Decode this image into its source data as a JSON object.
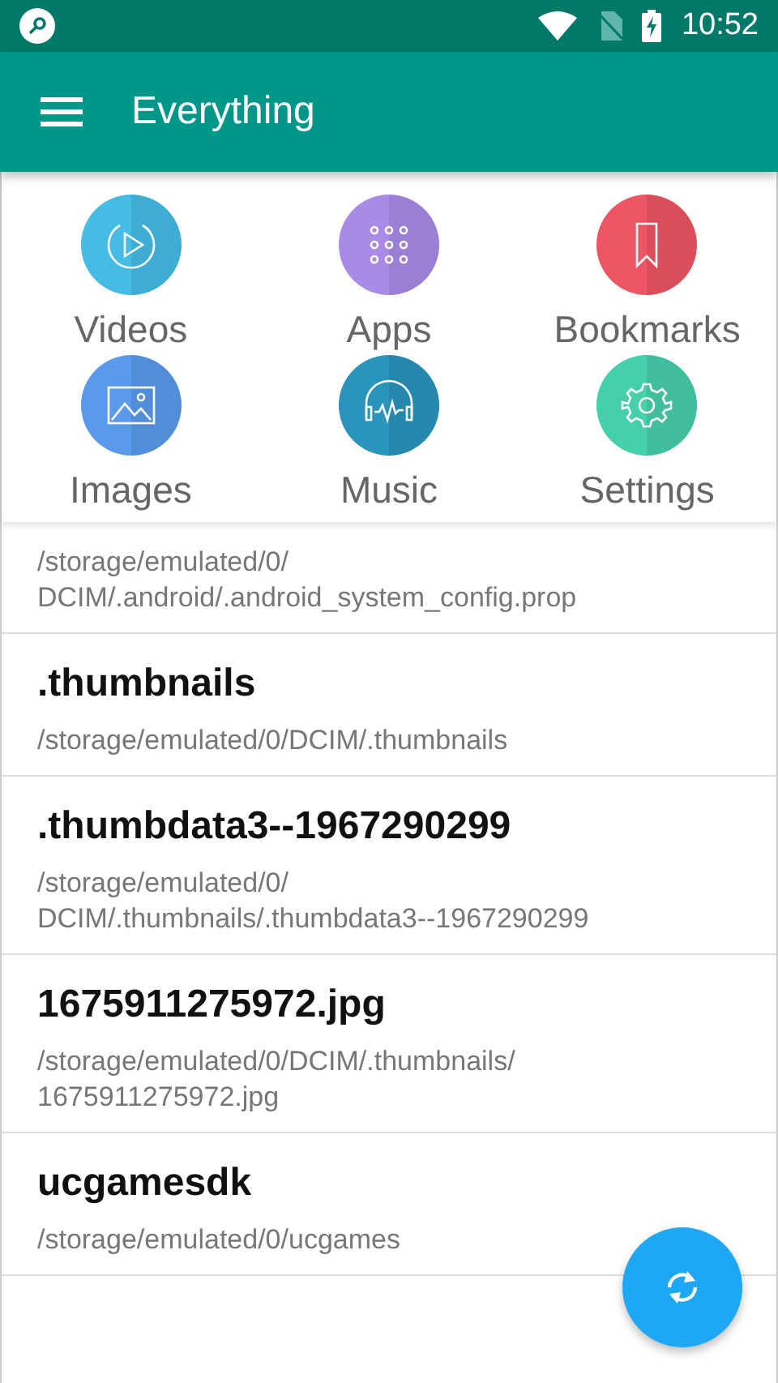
{
  "status_bar": {
    "time": "10:52"
  },
  "toolbar": {
    "title": "Everything"
  },
  "categories": [
    {
      "kind": "videos",
      "label": "Videos",
      "color": "#45bbe6"
    },
    {
      "kind": "apps",
      "label": "Apps",
      "color": "#a98ae6"
    },
    {
      "kind": "bookmarks",
      "label": "Bookmarks",
      "color": "#ec5563"
    },
    {
      "kind": "images",
      "label": "Images",
      "color": "#5a9aeb"
    },
    {
      "kind": "music",
      "label": "Music",
      "color": "#2b94bd"
    },
    {
      "kind": "settings",
      "label": "Settings",
      "color": "#46cfab"
    }
  ],
  "files": [
    {
      "path": "/storage/emulated/0/\nDCIM/.android/.android_system_config.prop"
    },
    {
      "name": ".thumbnails",
      "path": "/storage/emulated/0/DCIM/.thumbnails"
    },
    {
      "name": ".thumbdata3--1967290299",
      "path": "/storage/emulated/0/\nDCIM/.thumbnails/.thumbdata3--1967290299"
    },
    {
      "name": "1675911275972.jpg",
      "path": "/storage/emulated/0/DCIM/.thumbnails/\n1675911275972.jpg"
    },
    {
      "name": "ucgamesdk",
      "path": "/storage/emulated/0/ucgames"
    }
  ]
}
